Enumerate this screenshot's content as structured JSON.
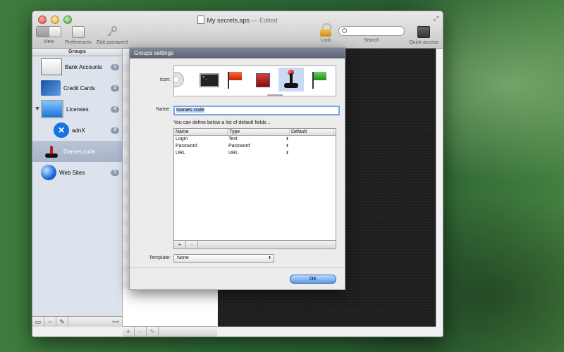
{
  "window": {
    "title": "My secrets.aps",
    "title_suffix": "— Edited"
  },
  "toolbar": {
    "view_label": "View",
    "preferences_label": "Preferences",
    "edit_password_label": "Edit password",
    "lock_label": "Lock",
    "search_label": "Search",
    "search_placeholder": "",
    "quick_access_label": "Quick access"
  },
  "sidebar": {
    "header": "Groups",
    "items": [
      {
        "label": "Bank Accounts",
        "count": "1",
        "icon": "bank-icon"
      },
      {
        "label": "Credit Cards",
        "count": "1",
        "icon": "credit-card-icon"
      },
      {
        "label": "Licenses",
        "count": "4",
        "icon": "monitor-icon"
      },
      {
        "label": "adnX",
        "count": "4",
        "icon": "adnx-icon"
      },
      {
        "label": "Games code",
        "count": "",
        "icon": "joystick-icon"
      },
      {
        "label": "Web Sites",
        "count": "1",
        "icon": "globe-icon"
      }
    ],
    "footer": {
      "add_folder": "▭",
      "remove": "−",
      "edit": "✎",
      "split": "⟺"
    }
  },
  "list_footer": {
    "add": "+",
    "remove": "−",
    "edit": "✎"
  },
  "sheet": {
    "title": "Groups settings",
    "icon_label": "Icon:",
    "name_label": "Name:",
    "name_value": "Games code",
    "fields_note": "You can define below a list of default fields...",
    "columns": [
      "Name",
      "Type",
      "Default"
    ],
    "rows": [
      {
        "name": "Login",
        "type": "Text"
      },
      {
        "name": "Password",
        "type": "Password"
      },
      {
        "name": "URL",
        "type": "URL"
      }
    ],
    "add_field": "+",
    "remove_field": "−",
    "template_label": "Template:",
    "template_value": "None",
    "ok_label": "OK"
  },
  "colors": {
    "sidebar_bg": "#dde3ec",
    "selection": "#a6b3c9",
    "sheet_title": "#5c6374",
    "ok_button": "#5b9bea",
    "badge": "#8e9ab0"
  }
}
